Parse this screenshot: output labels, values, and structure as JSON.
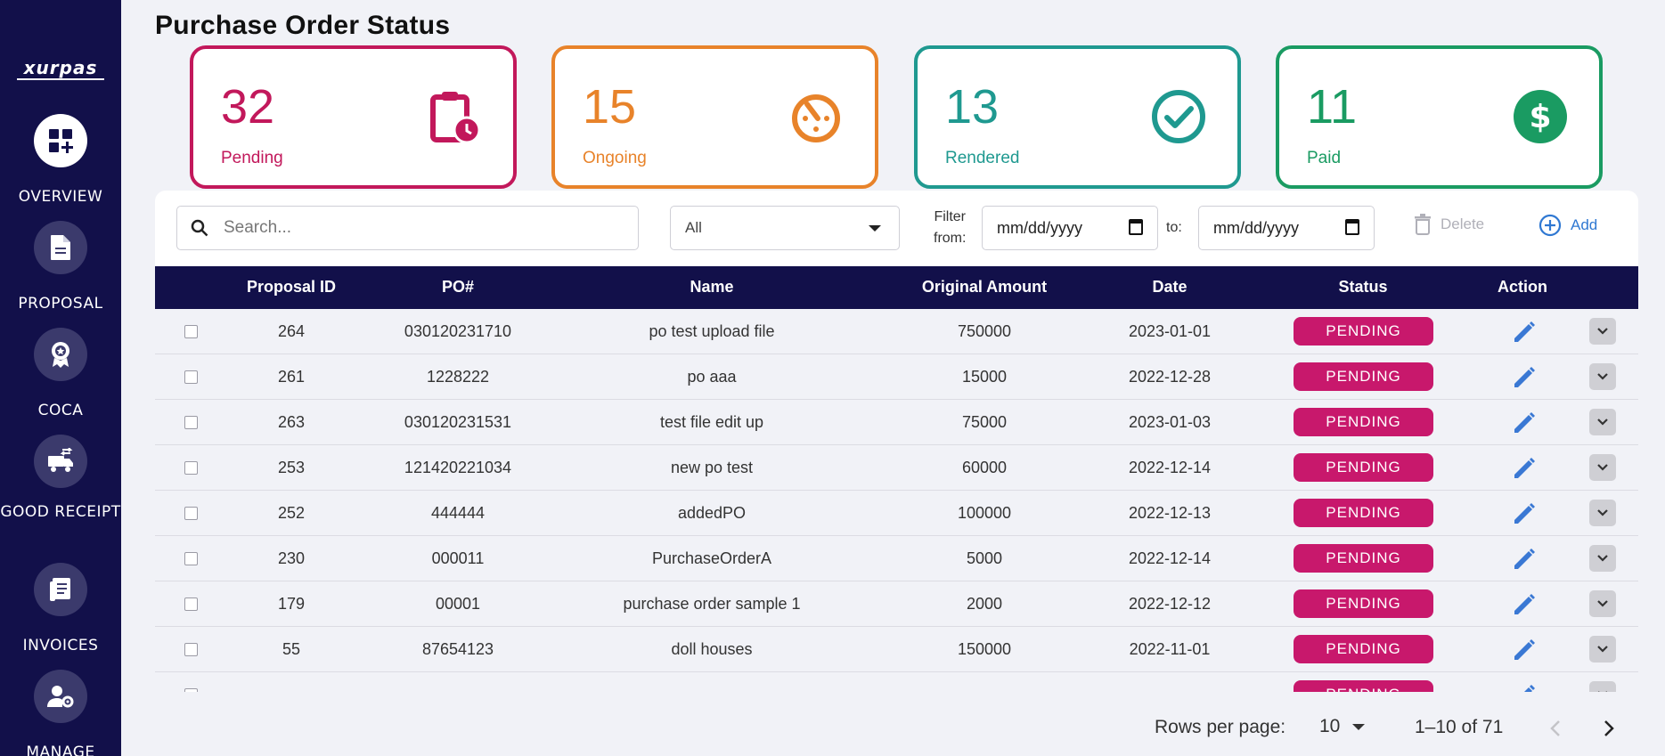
{
  "app": {
    "logo_text": "xurpas",
    "page_title": "Purchase Order Status"
  },
  "sidebar": {
    "items": [
      {
        "label": "OVERVIEW",
        "icon": "dashboard-add-icon",
        "active": true
      },
      {
        "label": "PROPOSAL",
        "icon": "document-icon",
        "active": false
      },
      {
        "label": "COCA",
        "icon": "badge-icon",
        "active": false
      },
      {
        "label": "GOOD RECEIPT",
        "icon": "truck-swap-icon",
        "active": false
      },
      {
        "label": "INVOICES",
        "icon": "invoice-icon",
        "active": false
      },
      {
        "label": "MANAGE",
        "icon": "user-gear-icon",
        "active": false
      }
    ]
  },
  "cards": [
    {
      "count": "32",
      "label": "Pending",
      "color": "#c2185b",
      "icon": "clipboard-clock-icon"
    },
    {
      "count": "15",
      "label": "Ongoing",
      "color": "#e8832a",
      "icon": "timer-icon"
    },
    {
      "count": "13",
      "label": "Rendered",
      "color": "#1f9990",
      "icon": "check-circle-icon"
    },
    {
      "count": "11",
      "label": "Paid",
      "color": "#1a9b62",
      "icon": "dollar-circle-icon"
    }
  ],
  "toolbar": {
    "search_placeholder": "Search...",
    "status_filter": "All",
    "filter_from_line1": "Filter",
    "filter_from_line2": "from:",
    "date_from": "mm/dd/yyyy",
    "to_label": "to:",
    "date_to": "mm/dd/yyyy",
    "delete_label": "Delete",
    "add_label": "Add"
  },
  "table": {
    "columns": [
      "Proposal ID",
      "PO#",
      "Name",
      "Original Amount",
      "Date",
      "Status",
      "Action"
    ],
    "rows": [
      {
        "id": "264",
        "po": "030120231710",
        "name": "po test upload file",
        "amount": "750000",
        "date": "2023-01-01",
        "status": "PENDING"
      },
      {
        "id": "261",
        "po": "1228222",
        "name": "po aaa",
        "amount": "15000",
        "date": "2022-12-28",
        "status": "PENDING"
      },
      {
        "id": "263",
        "po": "030120231531",
        "name": "test file edit up",
        "amount": "75000",
        "date": "2023-01-03",
        "status": "PENDING"
      },
      {
        "id": "253",
        "po": "121420221034",
        "name": "new po test",
        "amount": "60000",
        "date": "2022-12-14",
        "status": "PENDING"
      },
      {
        "id": "252",
        "po": "444444",
        "name": "addedPO",
        "amount": "100000",
        "date": "2022-12-13",
        "status": "PENDING"
      },
      {
        "id": "230",
        "po": "000011",
        "name": "PurchaseOrderA",
        "amount": "5000",
        "date": "2022-12-14",
        "status": "PENDING"
      },
      {
        "id": "179",
        "po": "00001",
        "name": "purchase order sample 1",
        "amount": "2000",
        "date": "2022-12-12",
        "status": "PENDING"
      },
      {
        "id": "55",
        "po": "87654123",
        "name": "doll houses",
        "amount": "150000",
        "date": "2022-11-01",
        "status": "PENDING"
      },
      {
        "id": "",
        "po": "",
        "name": "",
        "amount": "",
        "date": "",
        "status": "PENDING"
      }
    ]
  },
  "pagination": {
    "rows_per_page_label": "Rows per page:",
    "rows_per_page": "10",
    "range": "1–10 of 71"
  },
  "colors": {
    "sidebar": "#12104a",
    "header": "#12104a",
    "status_pending": "#c8186c",
    "edit_icon": "#3a78d4"
  }
}
